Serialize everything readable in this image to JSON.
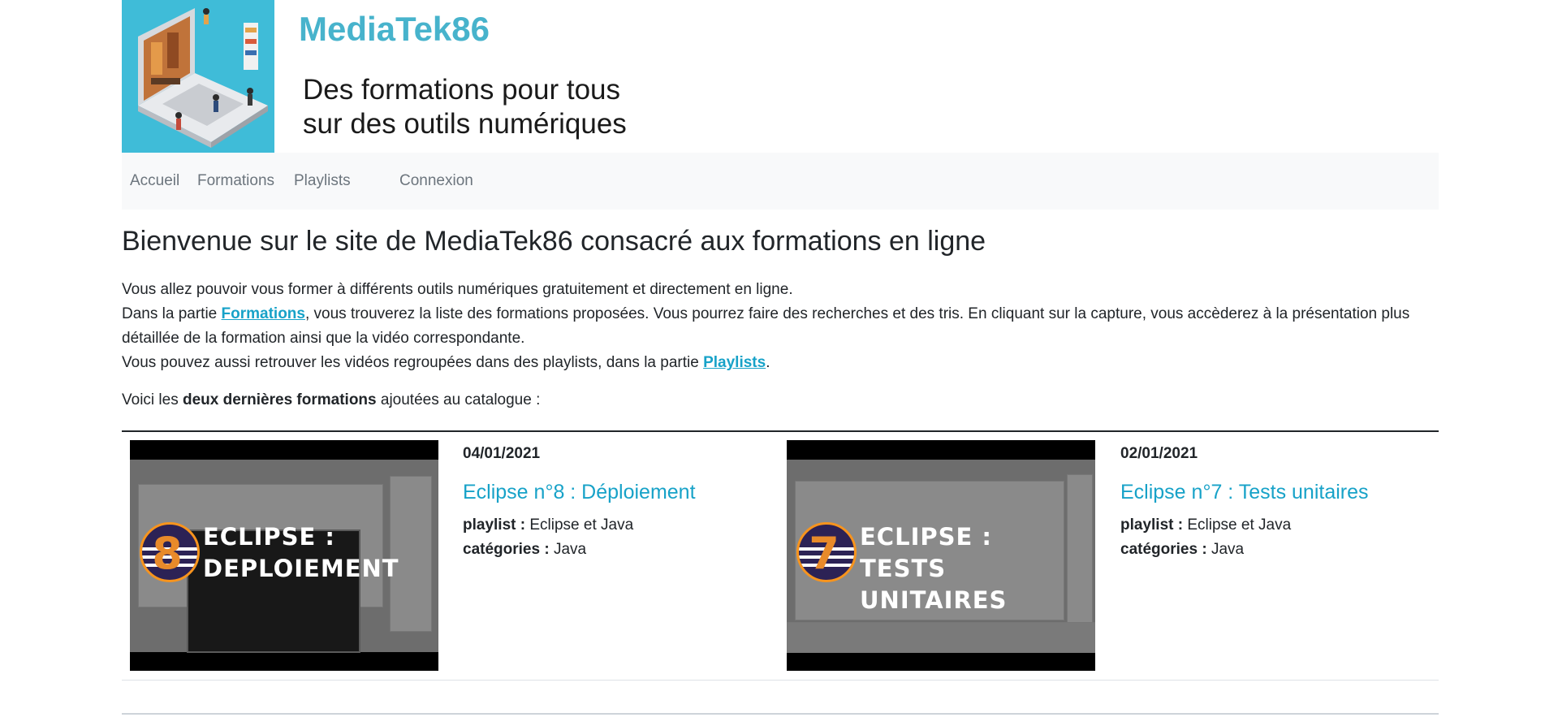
{
  "brand": {
    "name": "MediaTek86",
    "tagline_line1": "Des formations pour tous",
    "tagline_line2": "sur des outils numériques"
  },
  "nav": {
    "home": "Accueil",
    "formations": "Formations",
    "playlists": "Playlists",
    "login": "Connexion"
  },
  "main": {
    "title": "Bienvenue sur le site de MediaTek86 consacré aux formations en ligne",
    "intro_line1": "Vous allez pouvoir vous former à différents outils numériques gratuitement et directement en ligne.",
    "intro_line2_before": "Dans la partie ",
    "intro_line2_link": "Formations",
    "intro_line2_after": ", vous trouverez la liste des formations proposées. Vous pourrez faire des recherches et des tris. En cliquant sur la capture, vous accèderez à la présentation plus détaillée de la formation ainsi que la vidéo correspondante.",
    "intro_line3_before": "Vous pouvez aussi retrouver les vidéos regroupées dans des playlists, dans la partie ",
    "intro_line3_link": "Playlists",
    "intro_line3_after": ".",
    "latest_before": "Voici les ",
    "latest_bold": "deux dernières formations",
    "latest_after": " ajoutées au catalogue :"
  },
  "formations": [
    {
      "thumb_number": "8",
      "thumb_line1": "ECLIPSE :",
      "thumb_line2": "DEPLOIEMENT",
      "date": "04/01/2021",
      "title": "Eclipse n°8 : Déploiement",
      "playlist_label": "playlist :",
      "playlist": "Eclipse et Java",
      "categories_label": "catégories :",
      "categories": "Java"
    },
    {
      "thumb_number": "7",
      "thumb_line1": "ECLIPSE :",
      "thumb_line2": "TESTS UNITAIRES",
      "date": "02/01/2021",
      "title": "Eclipse n°7 : Tests unitaires",
      "playlist_label": "playlist :",
      "playlist": "Eclipse et Java",
      "categories_label": "catégories :",
      "categories": "Java"
    }
  ],
  "colors": {
    "link": "#17a2c8",
    "brand": "#47b3cc",
    "banner_bg": "#3fbcd8",
    "navbar_bg": "#f8f9fa",
    "badge_ring": "#f7941d",
    "badge_fill": "#2c2255"
  },
  "icons": {
    "banner": "laptop-illustration",
    "thumb_badge": "eclipse-logo-icon"
  }
}
